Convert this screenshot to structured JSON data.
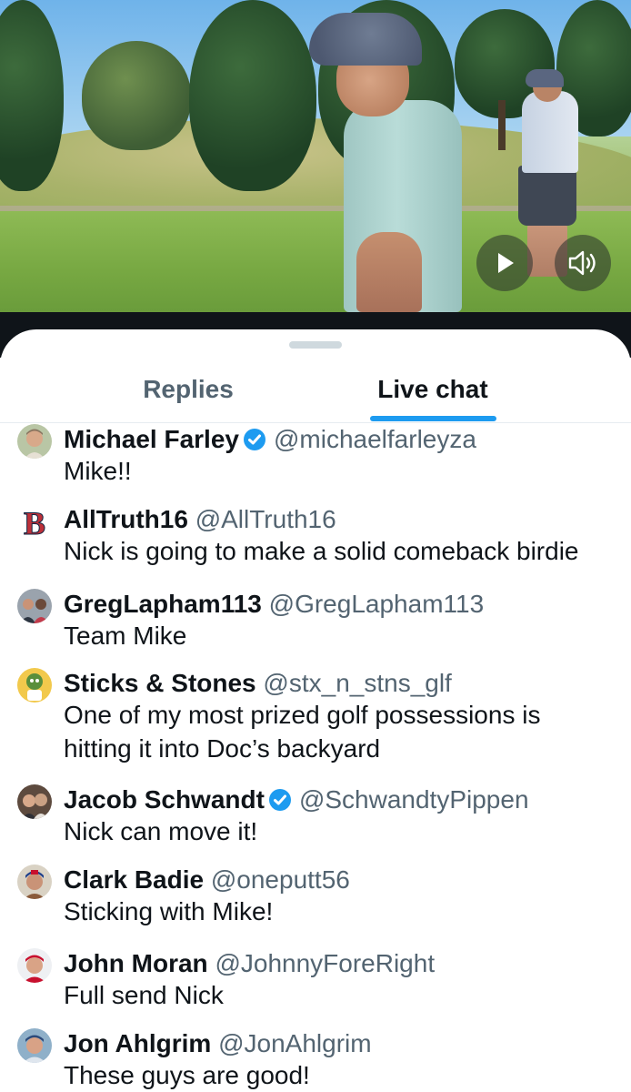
{
  "video": {
    "play_icon": "play-icon",
    "volume_icon": "volume-icon"
  },
  "tabs": [
    {
      "label": "Replies",
      "active": false
    },
    {
      "label": "Live chat",
      "active": true
    }
  ],
  "accent_color": "#1d9bf0",
  "messages": [
    {
      "name": "Michael Farley",
      "verified": true,
      "handle": "@michaelfarleyza",
      "lines": [
        "Mike!!"
      ]
    },
    {
      "name": "AllTruth16",
      "verified": false,
      "handle": "@AllTruth16",
      "lines": [
        "Nick is going to make a solid comeback birdie"
      ]
    },
    {
      "name": "GregLapham113",
      "verified": false,
      "handle": "@GregLapham113",
      "lines": [
        "Team Mike"
      ]
    },
    {
      "name": "Sticks & Stones",
      "verified": false,
      "handle": "@stx_n_stns_glf",
      "lines": [
        "One of my most prized golf possessions is",
        "hitting it into Doc’s backyard"
      ]
    },
    {
      "name": "Jacob Schwandt",
      "verified": true,
      "handle": "@SchwandtyPippen",
      "lines": [
        "Nick can move it!"
      ]
    },
    {
      "name": "Clark Badie",
      "verified": false,
      "handle": "@oneputt56",
      "lines": [
        "Sticking with Mike!"
      ]
    },
    {
      "name": "John Moran",
      "verified": false,
      "handle": "@JohnnyForeRight",
      "lines": [
        "Full send Nick"
      ]
    },
    {
      "name": "Jon Ahlgrim",
      "verified": false,
      "handle": "@JonAhlgrim",
      "lines": [
        "These guys are good!"
      ]
    }
  ]
}
